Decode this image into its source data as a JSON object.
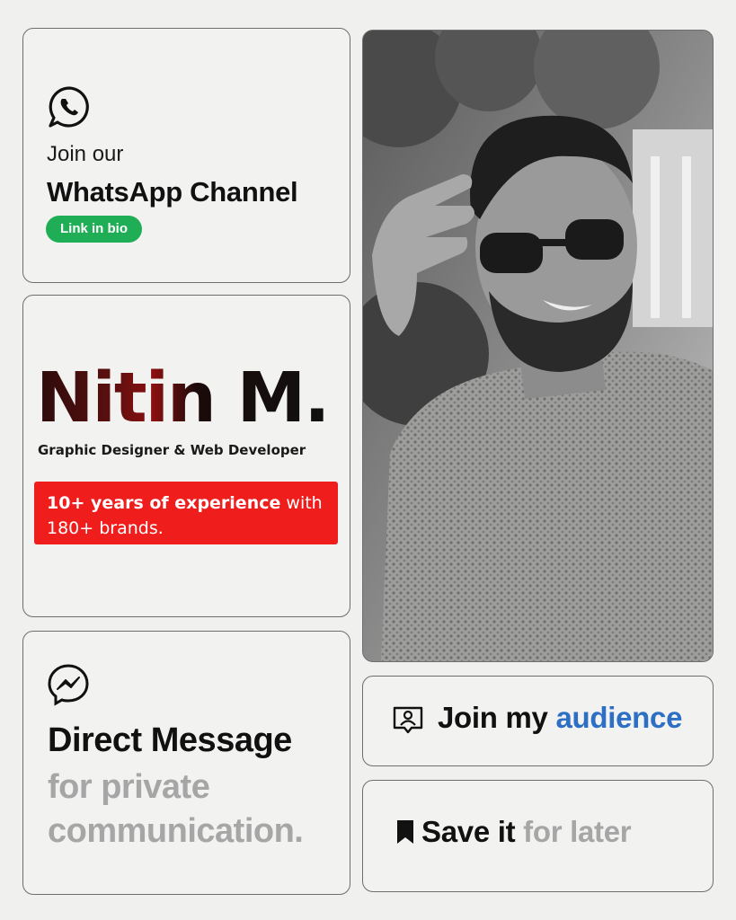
{
  "whatsapp": {
    "icon": "whatsapp-icon",
    "line1": "Join our",
    "line2": "WhatsApp Channel",
    "pill": "Link in bio",
    "pill_color": "#1fae56"
  },
  "profile": {
    "name": "Nitin M.",
    "role": "Graphic Designer & Web Developer",
    "experience_bold": "10+ years of experience",
    "experience_rest": " with 180+ brands.",
    "accent_color": "#f01d1d"
  },
  "photo": {
    "description": "portrait-photo"
  },
  "direct_message": {
    "icon": "messenger-icon",
    "line1": "Direct Message",
    "line2": "for private",
    "line3": "communication."
  },
  "audience": {
    "icon": "audience-icon",
    "text_prefix": "Join my ",
    "text_highlight": "audience",
    "highlight_color": "#2d6fc4"
  },
  "save": {
    "icon": "bookmark-icon",
    "text_bold": "Save it",
    "text_rest": " for later"
  }
}
